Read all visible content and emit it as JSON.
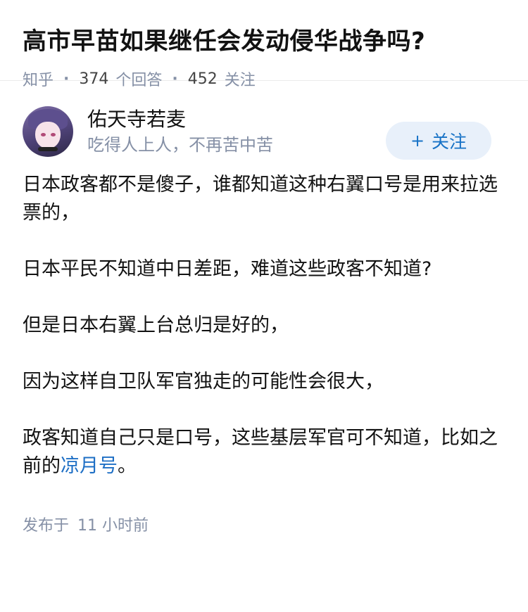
{
  "question": {
    "title": "高市早苗如果继任会发动侵华战争吗?",
    "site": "知乎",
    "answer_count": "374",
    "answer_label": "个回答",
    "follower_count": "452",
    "follower_label": "关注"
  },
  "author": {
    "name": "佑天寺若麦",
    "bio": "吃得人上人，不再苦中苦",
    "follow_button": "关注",
    "follow_icon": "plus-icon"
  },
  "answer": {
    "paragraphs": [
      "日本政客都不是傻子，谁都知道这种右翼口号是用来拉选票的，",
      "日本平民不知道中日差距，难道这些政客不知道?",
      "但是日本右翼上台总归是好的，",
      "因为这样自卫队军官独走的可能性会很大，"
    ],
    "last_paragraph_text": "政客知道自己只是口号，这些基层军官可不知道，比如之前的",
    "last_paragraph_link": "凉月号",
    "last_paragraph_end": "。"
  },
  "footer": {
    "published_label": "发布于",
    "published_time": "11 小时前"
  },
  "colors": {
    "link": "#1e6fc5",
    "meta_gray": "#8590a6",
    "follow_bg": "#e8f0fa"
  }
}
